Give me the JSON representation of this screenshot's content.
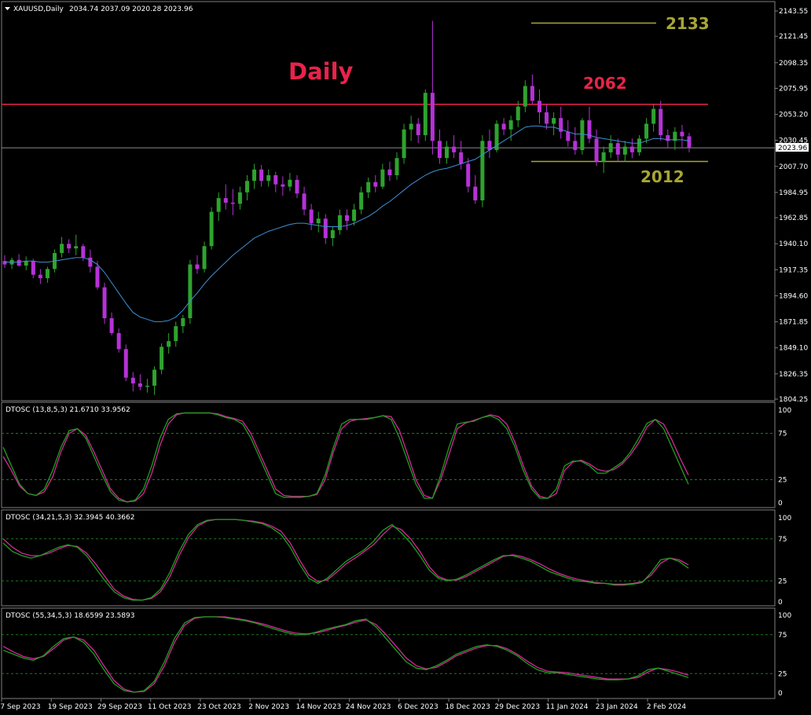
{
  "header": {
    "symbol": "XAUUSD,Daily",
    "ohlc": "2034.74 2037.09 2020.28 2023.96"
  },
  "chart_data": {
    "type": "candlestick",
    "ylim": [
      1804.25,
      2143.55
    ],
    "price_ticks": [
      "2143.55",
      "2121.45",
      "2098.35",
      "2075.95",
      "2053.20",
      "2030.45",
      "2007.70",
      "1984.95",
      "1962.85",
      "1940.10",
      "1917.35",
      "1894.60",
      "1871.85",
      "1849.10",
      "1826.35",
      "1804.25"
    ],
    "current_price": "2023.96",
    "x_labels": [
      "7 Sep 2023",
      "19 Sep 2023",
      "29 Sep 2023",
      "11 Oct 2023",
      "23 Oct 2023",
      "2 Nov 2023",
      "14 Nov 2023",
      "24 Nov 2023",
      "6 Dec 2023",
      "18 Dec 2023",
      "29 Dec 2023",
      "11 Jan 2024",
      "23 Jan 2024",
      "2 Feb 2024"
    ],
    "annotations": {
      "timeframe": "Daily",
      "level_2133": "2133",
      "level_2062": "2062",
      "level_2012": "2012"
    },
    "levels": [
      2133,
      2062,
      2012
    ],
    "candles": [
      [
        1925,
        1930,
        1919,
        1922
      ],
      [
        1922,
        1928,
        1918,
        1926
      ],
      [
        1926,
        1931,
        1920,
        1921
      ],
      [
        1921,
        1929,
        1917,
        1925
      ],
      [
        1925,
        1927,
        1910,
        1913
      ],
      [
        1913,
        1918,
        1905,
        1910
      ],
      [
        1910,
        1920,
        1906,
        1918
      ],
      [
        1918,
        1935,
        1915,
        1932
      ],
      [
        1932,
        1946,
        1928,
        1940
      ],
      [
        1940,
        1944,
        1932,
        1936
      ],
      [
        1936,
        1948,
        1930,
        1938
      ],
      [
        1938,
        1940,
        1925,
        1928
      ],
      [
        1928,
        1935,
        1915,
        1920
      ],
      [
        1920,
        1925,
        1900,
        1902
      ],
      [
        1902,
        1906,
        1870,
        1875
      ],
      [
        1875,
        1880,
        1860,
        1862
      ],
      [
        1862,
        1866,
        1845,
        1848
      ],
      [
        1848,
        1852,
        1820,
        1823
      ],
      [
        1823,
        1828,
        1811,
        1818
      ],
      [
        1818,
        1826,
        1812,
        1815
      ],
      [
        1815,
        1822,
        1810,
        1816
      ],
      [
        1816,
        1833,
        1808,
        1830
      ],
      [
        1830,
        1853,
        1826,
        1850
      ],
      [
        1850,
        1862,
        1844,
        1855
      ],
      [
        1855,
        1872,
        1850,
        1868
      ],
      [
        1868,
        1878,
        1862,
        1875
      ],
      [
        1875,
        1926,
        1870,
        1922
      ],
      [
        1922,
        1930,
        1914,
        1918
      ],
      [
        1918,
        1942,
        1915,
        1938
      ],
      [
        1938,
        1972,
        1935,
        1968
      ],
      [
        1968,
        1985,
        1960,
        1980
      ],
      [
        1980,
        1992,
        1970,
        1976
      ],
      [
        1976,
        1988,
        1965,
        1975
      ],
      [
        1975,
        1990,
        1970,
        1985
      ],
      [
        1985,
        2000,
        1978,
        1995
      ],
      [
        1995,
        2010,
        1988,
        2005
      ],
      [
        2005,
        2009,
        1990,
        1995
      ],
      [
        1995,
        2005,
        1990,
        2000
      ],
      [
        2000,
        2003,
        1985,
        1992
      ],
      [
        1992,
        1999,
        1982,
        1990
      ],
      [
        1990,
        2002,
        1986,
        1996
      ],
      [
        1996,
        2000,
        1980,
        1984
      ],
      [
        1984,
        1990,
        1965,
        1970
      ],
      [
        1970,
        1975,
        1952,
        1958
      ],
      [
        1958,
        1968,
        1950,
        1962
      ],
      [
        1962,
        1966,
        1940,
        1945
      ],
      [
        1945,
        1955,
        1938,
        1952
      ],
      [
        1952,
        1970,
        1948,
        1965
      ],
      [
        1965,
        1970,
        1952,
        1960
      ],
      [
        1960,
        1975,
        1956,
        1970
      ],
      [
        1970,
        1990,
        1966,
        1985
      ],
      [
        1985,
        1998,
        1980,
        1994
      ],
      [
        1994,
        2000,
        1985,
        1990
      ],
      [
        1990,
        2010,
        1988,
        2005
      ],
      [
        2005,
        2012,
        1995,
        2000
      ],
      [
        2000,
        2020,
        1996,
        2015
      ],
      [
        2015,
        2045,
        2010,
        2040
      ],
      [
        2040,
        2052,
        2030,
        2045
      ],
      [
        2045,
        2050,
        2028,
        2035
      ],
      [
        2035,
        2075,
        2030,
        2072
      ],
      [
        2072,
        2135,
        2018,
        2030
      ],
      [
        2030,
        2040,
        2010,
        2015
      ],
      [
        2015,
        2030,
        2010,
        2025
      ],
      [
        2025,
        2035,
        2015,
        2020
      ],
      [
        2020,
        2030,
        2005,
        2010
      ],
      [
        2010,
        2015,
        1985,
        1990
      ],
      [
        1990,
        2000,
        1975,
        1978
      ],
      [
        1978,
        2035,
        1972,
        2030
      ],
      [
        2030,
        2040,
        2015,
        2022
      ],
      [
        2022,
        2048,
        2020,
        2045
      ],
      [
        2045,
        2050,
        2035,
        2040
      ],
      [
        2040,
        2052,
        2030,
        2048
      ],
      [
        2048,
        2065,
        2042,
        2060
      ],
      [
        2060,
        2083,
        2055,
        2078
      ],
      [
        2078,
        2088,
        2062,
        2065
      ],
      [
        2065,
        2075,
        2045,
        2055
      ],
      [
        2055,
        2062,
        2040,
        2045
      ],
      [
        2045,
        2055,
        2035,
        2050
      ],
      [
        2050,
        2060,
        2032,
        2038
      ],
      [
        2038,
        2048,
        2025,
        2030
      ],
      [
        2030,
        2042,
        2018,
        2022
      ],
      [
        2022,
        2050,
        2018,
        2048
      ],
      [
        2048,
        2060,
        2028,
        2032
      ],
      [
        2032,
        2040,
        2008,
        2012
      ],
      [
        2012,
        2025,
        2002,
        2020
      ],
      [
        2020,
        2035,
        2015,
        2028
      ],
      [
        2028,
        2032,
        2012,
        2018
      ],
      [
        2018,
        2030,
        2012,
        2025
      ],
      [
        2025,
        2032,
        2015,
        2020
      ],
      [
        2020,
        2035,
        2017,
        2032
      ],
      [
        2032,
        2050,
        2028,
        2045
      ],
      [
        2045,
        2062,
        2038,
        2058
      ],
      [
        2058,
        2065,
        2030,
        2035
      ],
      [
        2035,
        2040,
        2024,
        2030
      ],
      [
        2030,
        2042,
        2022,
        2038
      ],
      [
        2038,
        2044,
        2024,
        2034
      ],
      [
        2034,
        2037,
        2020,
        2024
      ]
    ],
    "ma": [
      1924,
      1924,
      1924,
      1925,
      1925,
      1924,
      1924,
      1925,
      1926,
      1927,
      1928,
      1928,
      1926,
      1922,
      1915,
      1906,
      1897,
      1888,
      1880,
      1876,
      1874,
      1872,
      1872,
      1873,
      1876,
      1882,
      1890,
      1897,
      1905,
      1912,
      1918,
      1924,
      1930,
      1935,
      1940,
      1945,
      1948,
      1951,
      1953,
      1955,
      1957,
      1958,
      1958,
      1957,
      1956,
      1955,
      1955,
      1955,
      1956,
      1958,
      1961,
      1964,
      1968,
      1973,
      1977,
      1982,
      1987,
      1992,
      1996,
      2000,
      2003,
      2005,
      2006,
      2008,
      2010,
      2012,
      2014,
      2018,
      2022,
      2026,
      2030,
      2034,
      2038,
      2042,
      2043,
      2043,
      2042,
      2042,
      2040,
      2038,
      2036,
      2036,
      2035,
      2033,
      2032,
      2031,
      2030,
      2029,
      2028,
      2028,
      2030,
      2032,
      2032,
      2031,
      2031,
      2031,
      2030
    ],
    "oscillators": [
      {
        "title": "DTOSC (13,8,5,3) 21.6710 33.9562",
        "levels": [
          "100",
          "75",
          "25",
          "0"
        ],
        "green": [
          60,
          40,
          20,
          10,
          8,
          15,
          35,
          60,
          78,
          80,
          70,
          50,
          30,
          12,
          3,
          1,
          3,
          15,
          40,
          70,
          90,
          96,
          97,
          97,
          97,
          97,
          95,
          92,
          90,
          85,
          70,
          50,
          30,
          10,
          6,
          6,
          6,
          7,
          10,
          30,
          60,
          85,
          90,
          90,
          90,
          92,
          94,
          90,
          70,
          45,
          20,
          5,
          5,
          30,
          60,
          85,
          87,
          88,
          92,
          94,
          90,
          80,
          60,
          35,
          15,
          5,
          5,
          15,
          40,
          45,
          45,
          40,
          32,
          32,
          38,
          44,
          55,
          70,
          86,
          90,
          80,
          60,
          40,
          20
        ],
        "magenta": [
          50,
          35,
          18,
          10,
          8,
          12,
          28,
          55,
          75,
          80,
          73,
          55,
          35,
          15,
          5,
          1,
          2,
          10,
          32,
          62,
          85,
          95,
          97,
          97,
          97,
          97,
          96,
          93,
          91,
          88,
          75,
          55,
          35,
          15,
          8,
          7,
          7,
          7,
          9,
          25,
          55,
          80,
          88,
          90,
          91,
          92,
          94,
          93,
          78,
          52,
          25,
          8,
          5,
          25,
          52,
          80,
          86,
          89,
          92,
          95,
          93,
          85,
          65,
          40,
          18,
          7,
          5,
          10,
          35,
          44,
          46,
          42,
          36,
          34,
          36,
          42,
          52,
          65,
          82,
          90,
          85,
          68,
          48,
          30
        ]
      },
      {
        "title": "DTOSC (34,21,5,3) 32.3945 40.3662",
        "levels": [
          "100",
          "75",
          "25",
          "0"
        ],
        "green": [
          70,
          60,
          55,
          52,
          55,
          60,
          65,
          68,
          65,
          55,
          40,
          25,
          12,
          5,
          2,
          2,
          5,
          15,
          35,
          60,
          80,
          92,
          97,
          98,
          98,
          98,
          97,
          95,
          93,
          88,
          80,
          65,
          45,
          28,
          22,
          28,
          38,
          48,
          55,
          62,
          72,
          85,
          92,
          82,
          70,
          55,
          38,
          28,
          25,
          27,
          32,
          38,
          44,
          50,
          55,
          55,
          52,
          48,
          42,
          36,
          32,
          28,
          25,
          24,
          22,
          22,
          20,
          20,
          21,
          23,
          35,
          50,
          52,
          48,
          40
        ],
        "magenta": [
          75,
          65,
          58,
          55,
          55,
          58,
          63,
          67,
          66,
          58,
          45,
          30,
          15,
          7,
          3,
          2,
          4,
          12,
          30,
          55,
          76,
          90,
          96,
          98,
          98,
          98,
          97,
          96,
          94,
          90,
          84,
          70,
          50,
          32,
          24,
          26,
          35,
          45,
          52,
          60,
          68,
          80,
          90,
          86,
          75,
          60,
          42,
          30,
          26,
          26,
          30,
          36,
          42,
          48,
          54,
          56,
          54,
          50,
          45,
          39,
          34,
          30,
          27,
          25,
          23,
          22,
          21,
          21,
          22,
          24,
          32,
          46,
          52,
          50,
          44
        ]
      },
      {
        "title": "DTOSC (55,34,5,3) 18.6599 23.5893",
        "levels": [
          "100",
          "75",
          "25",
          "0"
        ],
        "green": [
          55,
          50,
          45,
          42,
          48,
          60,
          70,
          72,
          65,
          50,
          30,
          12,
          3,
          1,
          3,
          15,
          40,
          70,
          90,
          97,
          98,
          98,
          97,
          95,
          93,
          90,
          86,
          82,
          78,
          75,
          75,
          78,
          82,
          85,
          88,
          93,
          95,
          85,
          70,
          55,
          40,
          32,
          30,
          35,
          42,
          50,
          55,
          60,
          62,
          60,
          55,
          48,
          38,
          30,
          26,
          26,
          24,
          22,
          20,
          18,
          17,
          17,
          18,
          22,
          30,
          32,
          28,
          24,
          20
        ],
        "magenta": [
          60,
          53,
          47,
          44,
          47,
          57,
          68,
          72,
          68,
          55,
          35,
          16,
          5,
          1,
          2,
          12,
          35,
          65,
          87,
          96,
          98,
          98,
          98,
          96,
          94,
          91,
          88,
          84,
          80,
          77,
          76,
          77,
          80,
          84,
          87,
          91,
          94,
          88,
          75,
          60,
          45,
          35,
          31,
          33,
          40,
          48,
          53,
          58,
          61,
          61,
          57,
          50,
          41,
          33,
          28,
          27,
          26,
          24,
          22,
          20,
          18,
          18,
          18,
          20,
          27,
          32,
          30,
          27,
          23
        ]
      }
    ]
  },
  "colors": {
    "bull": "#2ea32e",
    "bear": "#b532d6",
    "ma": "#3f8fd6",
    "level_red": "#e8234a",
    "level_olive": "#a8a635",
    "osc_green": "#1e9e1e",
    "osc_magenta": "#d6289a"
  }
}
